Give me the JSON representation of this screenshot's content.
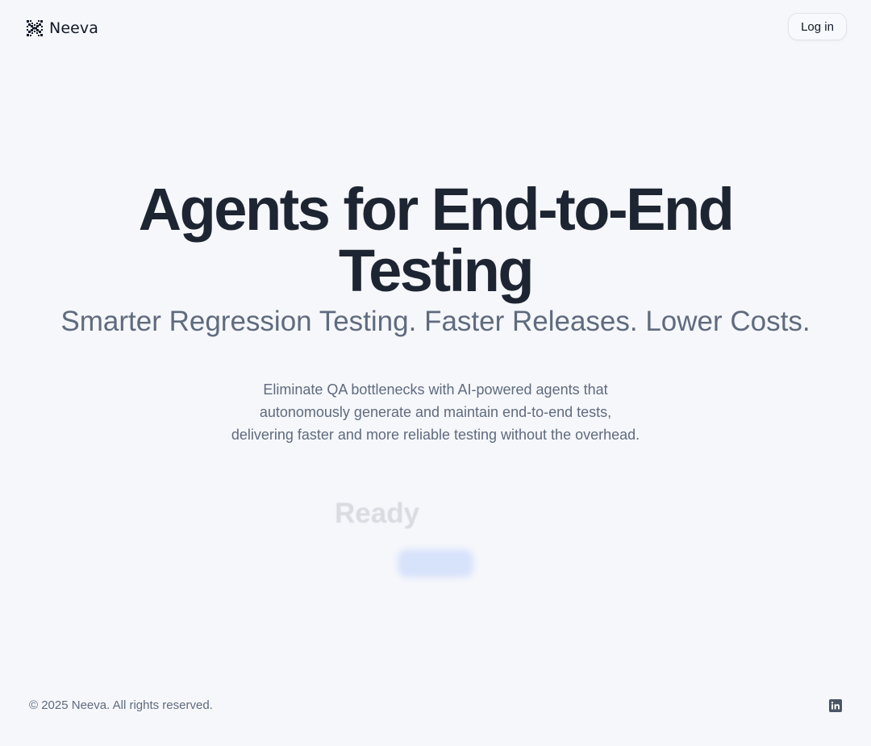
{
  "header": {
    "brand_name": "Neeva",
    "login_label": "Log in"
  },
  "hero": {
    "title": "Agents for End-to-End Testing",
    "subtitle": "Smarter Regression Testing. Faster Releases. Lower Costs.",
    "description_lines": [
      "Eliminate QA bottlenecks with AI-powered agents that",
      "autonomously generate and maintain end-to-end tests,",
      "delivering faster and more reliable testing without the overhead."
    ],
    "ready_text": "Ready"
  },
  "footer": {
    "copyright": "© 2025 Neeva. All rights reserved.",
    "social_icon": "linkedin-icon"
  },
  "colors": {
    "background": "#f6f7fb",
    "heading": "#1e2532",
    "muted": "#5f6b7e",
    "faded_text": "#d9dbe1",
    "cta_blur": "#d7e2fb"
  }
}
